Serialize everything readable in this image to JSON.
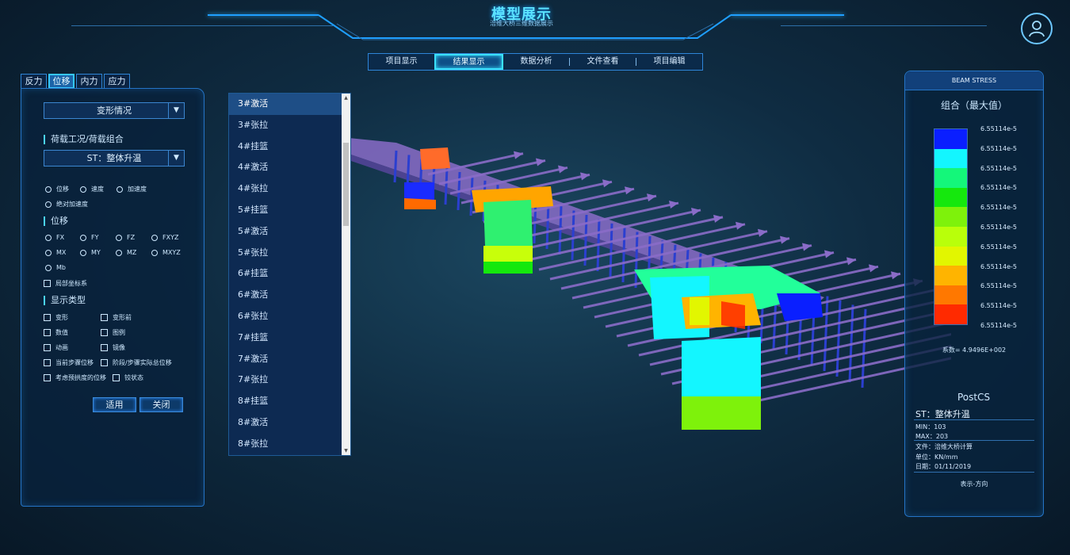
{
  "header": {
    "title": "模型展示",
    "subtitle": "涪维大桥三维数据展示"
  },
  "nav": {
    "items": [
      "项目显示",
      "结果显示",
      "数据分析",
      "文件查看",
      "项目编辑"
    ],
    "active_index": 1
  },
  "left_tabs": {
    "items": [
      "反力",
      "位移",
      "内力",
      "应力"
    ],
    "active_index": 1
  },
  "left_panel": {
    "deformation_select": "变形情况",
    "load_section": "荷载工况/荷载组合",
    "load_select": "ST：整体升温",
    "mode_options": [
      "位移",
      "速度",
      "加速度",
      "绝对加速度"
    ],
    "disp_section": "位移",
    "disp_options": [
      "FX",
      "FY",
      "FZ",
      "FXYZ",
      "MX",
      "MY",
      "MZ",
      "MXYZ",
      "Mb"
    ],
    "local_coord": "局部坐标系",
    "display_section": "显示类型",
    "display_options": [
      "变形",
      "变形前",
      "数值",
      "图例",
      "动画",
      "镜像",
      "当前步骤位移",
      "阶段/步骤实际总位移",
      "考虑预拱度的位移",
      "铰状态"
    ],
    "apply_button": "适用",
    "close_button": "关闭"
  },
  "step_list": {
    "items": [
      "3#激活",
      "3#张拉",
      "4#挂篮",
      "4#激活",
      "4#张拉",
      "5#挂篮",
      "5#激活",
      "5#张拉",
      "6#挂篮",
      "6#激活",
      "6#张拉",
      "7#挂篮",
      "7#激活",
      "7#张拉",
      "8#挂篮",
      "8#激活",
      "8#张拉"
    ],
    "selected_index": 0
  },
  "right_panel": {
    "header": "BEAM STRESS",
    "subtitle": "组合（最大值）",
    "legend_colors": [
      "#0a1fff",
      "#13f6ff",
      "#14f77a",
      "#15e80d",
      "#7ef20b",
      "#b9ff0a",
      "#e2f600",
      "#ffb400",
      "#ff7800",
      "#ff2a00"
    ],
    "legend_labels": [
      "6.55114e-5",
      "6.55114e-5",
      "6.55114e-5",
      "6.55114e-5",
      "6.55114e-5",
      "6.55114e-5",
      "6.55114e-5",
      "6.55114e-5",
      "6.55114e-5",
      "6.55114e-5",
      "6.55114e-5"
    ],
    "coefficient": "系数= 4.9496E+002",
    "postcs": "PostCS",
    "st_label": "ST：整体升温",
    "min": "MIN：103",
    "max": "MAX：203",
    "file": "文件：涪维大桥计算",
    "unit": "单位：KN/mm",
    "date": "日期：01/11/2019",
    "direction": "表示-方向"
  },
  "colors": {
    "accent": "#3ae0ff",
    "panel_border": "#2474c6",
    "deck": "#8a6cc8",
    "arrow": "#8a6cc8",
    "post": "#2b3fd0"
  }
}
